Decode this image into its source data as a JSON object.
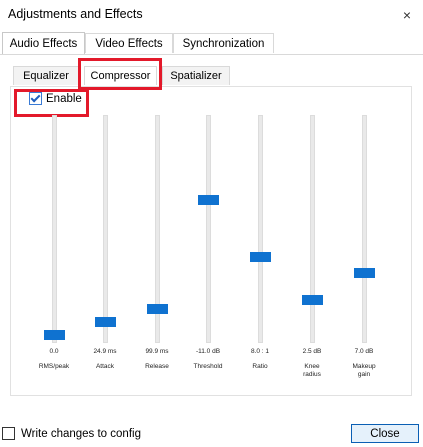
{
  "window": {
    "title": "Adjustments and Effects",
    "close_glyph": "×"
  },
  "tabs": [
    {
      "label": "Audio Effects",
      "active": true
    },
    {
      "label": "Video Effects",
      "active": false
    },
    {
      "label": "Synchronization",
      "active": false
    }
  ],
  "subtabs": [
    {
      "label": "Equalizer",
      "active": false
    },
    {
      "label": "Compressor",
      "active": true
    },
    {
      "label": "Spatializer",
      "active": false
    }
  ],
  "enable": {
    "label": "Enable",
    "checked": true
  },
  "sliders": [
    {
      "value": "0.0",
      "label": "RMS/peak"
    },
    {
      "value": "24.9 ms",
      "label": "Attack"
    },
    {
      "value": "99.9 ms",
      "label": "Release"
    },
    {
      "value": "-11.0 dB",
      "label": "Threshold"
    },
    {
      "value": "8.0 : 1",
      "label": "Ratio"
    },
    {
      "value": "2.5 dB",
      "label": "Knee\nradius"
    },
    {
      "value": "7.0 dB",
      "label": "Makeup\ngain"
    }
  ],
  "footer": {
    "write_config_label": "Write changes to config",
    "write_config_checked": false,
    "close_label": "Close"
  },
  "colors": {
    "accent": "#0f72d0",
    "highlight": "#e3192a"
  }
}
